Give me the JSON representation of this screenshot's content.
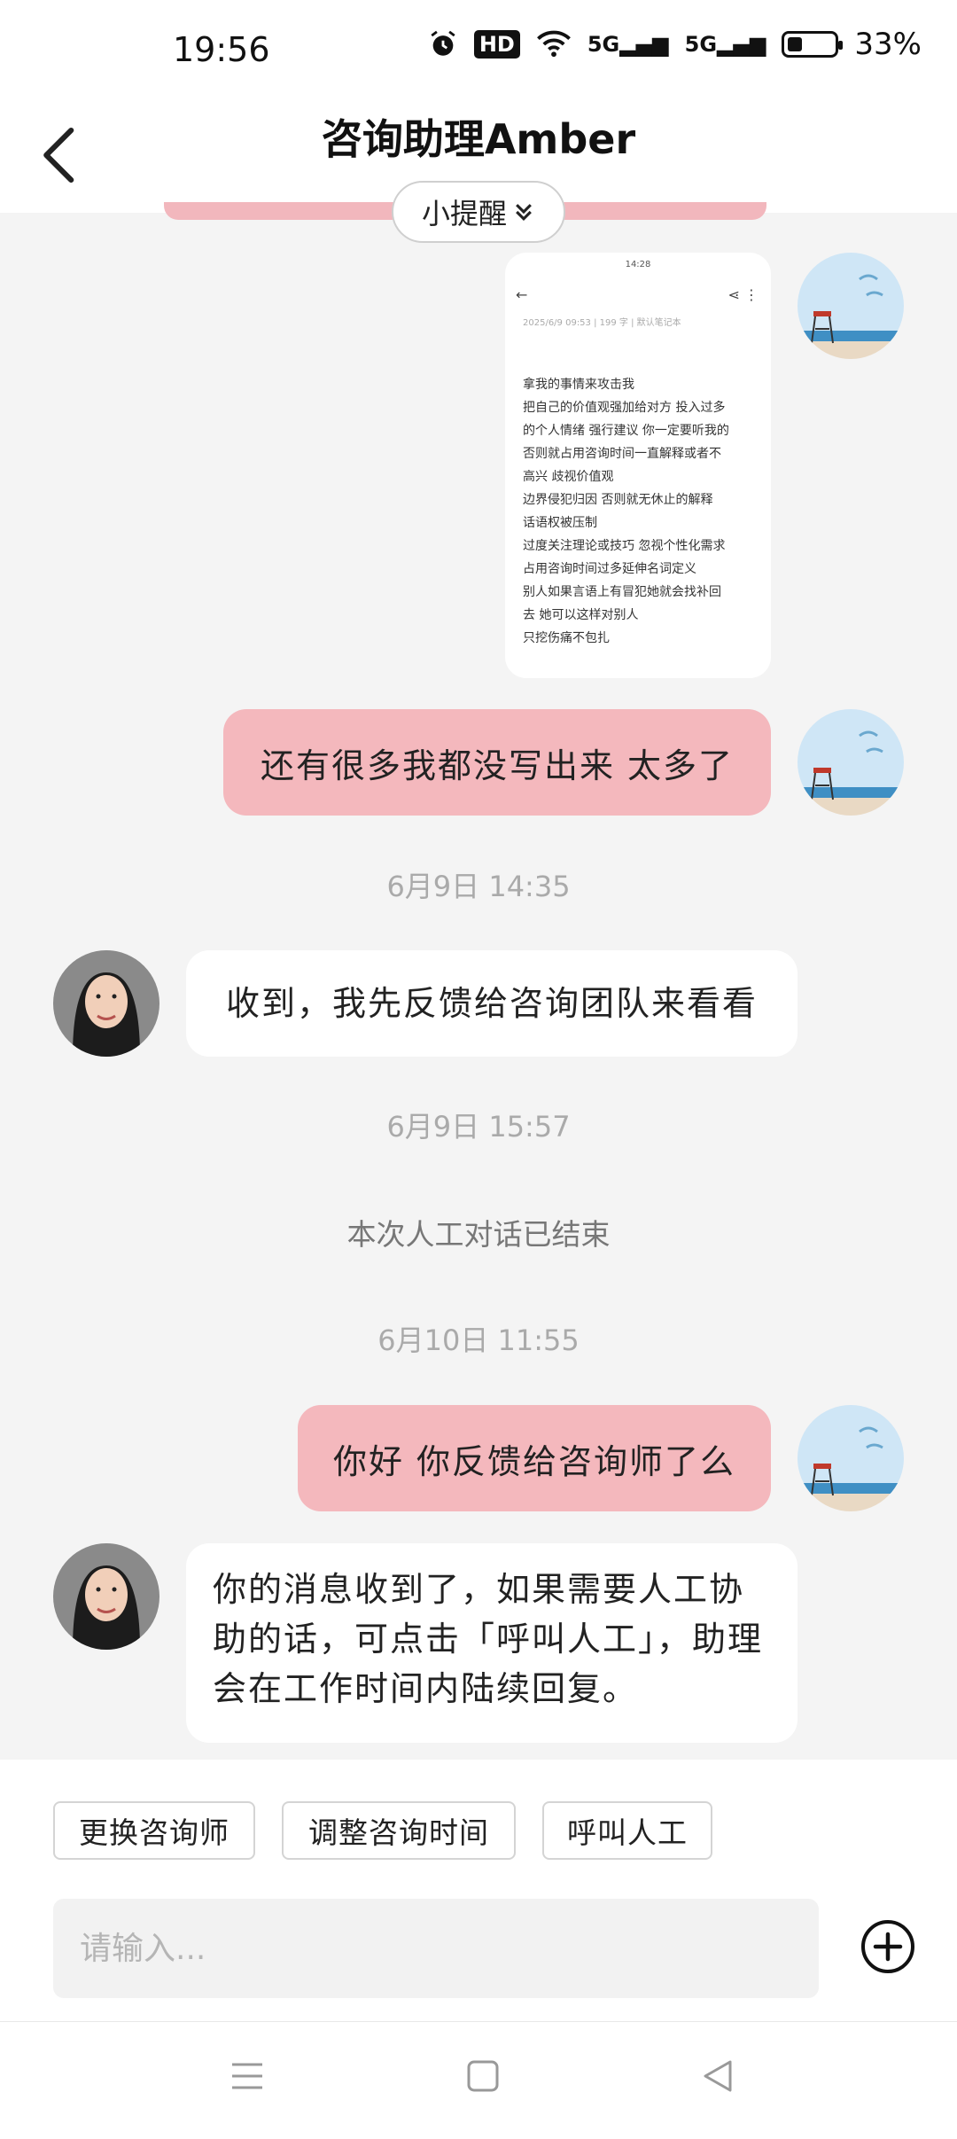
{
  "status_bar": {
    "time": "19:56",
    "hd_label": "HD",
    "signal1": "5G",
    "signal2": "5G",
    "battery": "33%"
  },
  "header": {
    "title": "咨询助理Amber",
    "reminder_label": "小提醒"
  },
  "screenshot_message": {
    "status_time": "14:28",
    "meta": "2025/6/9 09:53  |  199 字  |  默认笔记本",
    "text": "拿我的事情来攻击我\n把自己的价值观强加给对方 投入过多\n的个人情绪 强行建议 你一定要听我的\n否则就占用咨询时间一直解释或者不\n高兴 歧视价值观\n边界侵犯归因 否则就无休止的解释\n话语权被压制\n过度关注理论或技巧 忽视个性化需求\n占用咨询时间过多延伸名词定义\n别人如果言语上有冒犯她就会找补回\n去 她可以这样对别人\n只挖伤痛不包扎"
  },
  "messages": {
    "me_1": "还有很多我都没写出来 太多了",
    "ts_1": "6月9日  14:35",
    "them_1": "收到，我先反馈给咨询团队来看看",
    "ts_2": "6月9日  15:57",
    "system_1": "本次人工对话已结束",
    "ts_3": "6月10日  11:55",
    "me_2": "你好 你反馈给咨询师了么",
    "them_2": "你的消息收到了，如果需要人工协助的话，可点击「呼叫人工」，助理会在工作时间内陆续回复。"
  },
  "quick_actions": {
    "change": "更换咨询师",
    "adjust": "调整咨询时间",
    "call": "呼叫人工"
  },
  "composer": {
    "placeholder": "请输入..."
  },
  "colors": {
    "my_bubble": "#f4b8bd",
    "background": "#f4f4f4"
  }
}
